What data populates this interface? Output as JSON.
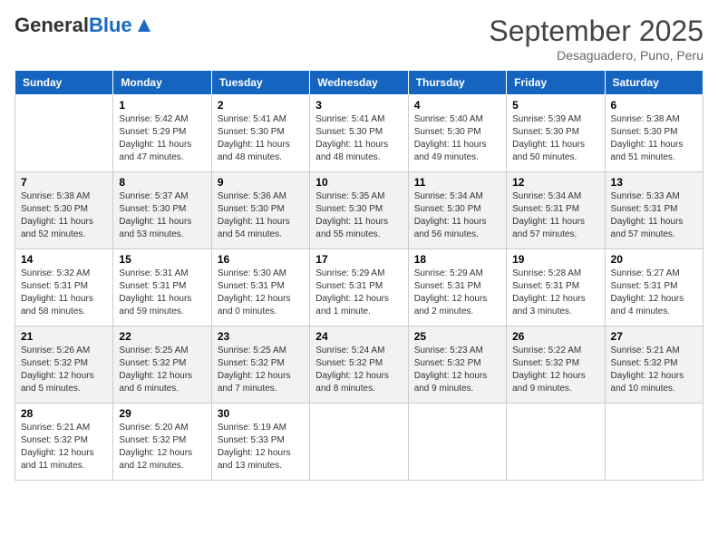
{
  "header": {
    "logo_general": "General",
    "logo_blue": "Blue",
    "month_title": "September 2025",
    "location": "Desaguadero, Puno, Peru"
  },
  "weekdays": [
    "Sunday",
    "Monday",
    "Tuesday",
    "Wednesday",
    "Thursday",
    "Friday",
    "Saturday"
  ],
  "weeks": [
    [
      {
        "day": "",
        "info": ""
      },
      {
        "day": "1",
        "info": "Sunrise: 5:42 AM\nSunset: 5:29 PM\nDaylight: 11 hours\nand 47 minutes."
      },
      {
        "day": "2",
        "info": "Sunrise: 5:41 AM\nSunset: 5:30 PM\nDaylight: 11 hours\nand 48 minutes."
      },
      {
        "day": "3",
        "info": "Sunrise: 5:41 AM\nSunset: 5:30 PM\nDaylight: 11 hours\nand 48 minutes."
      },
      {
        "day": "4",
        "info": "Sunrise: 5:40 AM\nSunset: 5:30 PM\nDaylight: 11 hours\nand 49 minutes."
      },
      {
        "day": "5",
        "info": "Sunrise: 5:39 AM\nSunset: 5:30 PM\nDaylight: 11 hours\nand 50 minutes."
      },
      {
        "day": "6",
        "info": "Sunrise: 5:38 AM\nSunset: 5:30 PM\nDaylight: 11 hours\nand 51 minutes."
      }
    ],
    [
      {
        "day": "7",
        "info": "Sunrise: 5:38 AM\nSunset: 5:30 PM\nDaylight: 11 hours\nand 52 minutes."
      },
      {
        "day": "8",
        "info": "Sunrise: 5:37 AM\nSunset: 5:30 PM\nDaylight: 11 hours\nand 53 minutes."
      },
      {
        "day": "9",
        "info": "Sunrise: 5:36 AM\nSunset: 5:30 PM\nDaylight: 11 hours\nand 54 minutes."
      },
      {
        "day": "10",
        "info": "Sunrise: 5:35 AM\nSunset: 5:30 PM\nDaylight: 11 hours\nand 55 minutes."
      },
      {
        "day": "11",
        "info": "Sunrise: 5:34 AM\nSunset: 5:30 PM\nDaylight: 11 hours\nand 56 minutes."
      },
      {
        "day": "12",
        "info": "Sunrise: 5:34 AM\nSunset: 5:31 PM\nDaylight: 11 hours\nand 57 minutes."
      },
      {
        "day": "13",
        "info": "Sunrise: 5:33 AM\nSunset: 5:31 PM\nDaylight: 11 hours\nand 57 minutes."
      }
    ],
    [
      {
        "day": "14",
        "info": "Sunrise: 5:32 AM\nSunset: 5:31 PM\nDaylight: 11 hours\nand 58 minutes."
      },
      {
        "day": "15",
        "info": "Sunrise: 5:31 AM\nSunset: 5:31 PM\nDaylight: 11 hours\nand 59 minutes."
      },
      {
        "day": "16",
        "info": "Sunrise: 5:30 AM\nSunset: 5:31 PM\nDaylight: 12 hours\nand 0 minutes."
      },
      {
        "day": "17",
        "info": "Sunrise: 5:29 AM\nSunset: 5:31 PM\nDaylight: 12 hours\nand 1 minute."
      },
      {
        "day": "18",
        "info": "Sunrise: 5:29 AM\nSunset: 5:31 PM\nDaylight: 12 hours\nand 2 minutes."
      },
      {
        "day": "19",
        "info": "Sunrise: 5:28 AM\nSunset: 5:31 PM\nDaylight: 12 hours\nand 3 minutes."
      },
      {
        "day": "20",
        "info": "Sunrise: 5:27 AM\nSunset: 5:31 PM\nDaylight: 12 hours\nand 4 minutes."
      }
    ],
    [
      {
        "day": "21",
        "info": "Sunrise: 5:26 AM\nSunset: 5:32 PM\nDaylight: 12 hours\nand 5 minutes."
      },
      {
        "day": "22",
        "info": "Sunrise: 5:25 AM\nSunset: 5:32 PM\nDaylight: 12 hours\nand 6 minutes."
      },
      {
        "day": "23",
        "info": "Sunrise: 5:25 AM\nSunset: 5:32 PM\nDaylight: 12 hours\nand 7 minutes."
      },
      {
        "day": "24",
        "info": "Sunrise: 5:24 AM\nSunset: 5:32 PM\nDaylight: 12 hours\nand 8 minutes."
      },
      {
        "day": "25",
        "info": "Sunrise: 5:23 AM\nSunset: 5:32 PM\nDaylight: 12 hours\nand 9 minutes."
      },
      {
        "day": "26",
        "info": "Sunrise: 5:22 AM\nSunset: 5:32 PM\nDaylight: 12 hours\nand 9 minutes."
      },
      {
        "day": "27",
        "info": "Sunrise: 5:21 AM\nSunset: 5:32 PM\nDaylight: 12 hours\nand 10 minutes."
      }
    ],
    [
      {
        "day": "28",
        "info": "Sunrise: 5:21 AM\nSunset: 5:32 PM\nDaylight: 12 hours\nand 11 minutes."
      },
      {
        "day": "29",
        "info": "Sunrise: 5:20 AM\nSunset: 5:32 PM\nDaylight: 12 hours\nand 12 minutes."
      },
      {
        "day": "30",
        "info": "Sunrise: 5:19 AM\nSunset: 5:33 PM\nDaylight: 12 hours\nand 13 minutes."
      },
      {
        "day": "",
        "info": ""
      },
      {
        "day": "",
        "info": ""
      },
      {
        "day": "",
        "info": ""
      },
      {
        "day": "",
        "info": ""
      }
    ]
  ]
}
